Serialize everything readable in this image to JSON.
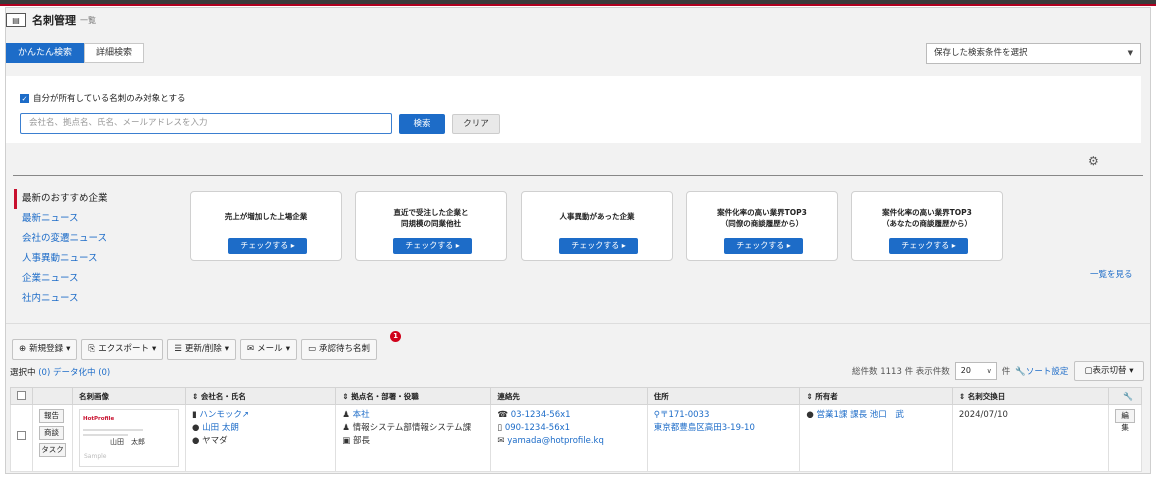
{
  "header": {
    "title": "名刺管理",
    "subtitle": "一覧",
    "icon": "contact-card-icon"
  },
  "search_tabs": [
    {
      "label": "かんたん検索",
      "active": true
    },
    {
      "label": "詳細検索",
      "active": false
    }
  ],
  "saved_search": {
    "placeholder": "保存した検索条件を選択"
  },
  "search": {
    "own_only_label": "自分が所有している名刺のみ対象とする",
    "own_only_checked": true,
    "placeholder": "会社名、拠点名、氏名、メールアドレスを入力",
    "search_label": "検索",
    "clear_label": "クリア"
  },
  "news_nav": [
    {
      "label": "最新のおすすめ企業",
      "active": true
    },
    {
      "label": "最新ニュース",
      "active": false
    },
    {
      "label": "会社の変遷ニュース",
      "active": false
    },
    {
      "label": "人事異動ニュース",
      "active": false
    },
    {
      "label": "企業ニュース",
      "active": false
    },
    {
      "label": "社内ニュース",
      "active": false
    }
  ],
  "cards": [
    {
      "line1": "売上が増加した上場企業",
      "line2": "",
      "button": "チェックする ▸"
    },
    {
      "line1": "直近で受注した企業と",
      "line2": "同規模の同業他社",
      "button": "チェックする ▸"
    },
    {
      "line1": "人事異動があった企業",
      "line2": "",
      "button": "チェックする ▸"
    },
    {
      "line1": "案件化率の高い業界TOP3",
      "line2": "（同僚の商談履歴から）",
      "button": "チェックする ▸"
    },
    {
      "line1": "案件化率の高い業界TOP3",
      "line2": "（あなたの商談履歴から）",
      "button": "チェックする ▸"
    }
  ],
  "see_all": "一覧を見る",
  "toolbar": {
    "new_label": "新規登録",
    "export_label": "エクスポート",
    "update_label": "更新/削除",
    "mail_label": "メール",
    "approval_label": "承認待ち名刺",
    "approval_badge": "1"
  },
  "selection": {
    "selected_label": "選択中",
    "selected_count": "(0)",
    "digitizing_label": "データ化中",
    "digitizing_count": "(0)"
  },
  "totals": {
    "total_label": "総件数",
    "total_count": "1113",
    "unit": "件",
    "per_page_label": "表示件数",
    "per_page_value": "20",
    "per_page_unit": "件",
    "sort_label": "ソート設定",
    "view_label": "表示切替"
  },
  "columns": [
    "名刺画像",
    "会社名・氏名",
    "拠点名・部署・役職",
    "連絡先",
    "住所",
    "所有者",
    "名刺交換日"
  ],
  "row": {
    "actions": [
      "報告",
      "商談",
      "タスク"
    ],
    "card_logo": "HotProfile",
    "card_name": "山田　太郎",
    "card_sample": "Sample",
    "company": "ハンモック",
    "person": "山田 太朗",
    "kana": "ヤマダ",
    "branch": "本社",
    "department": "情報システム部情報システム課",
    "title": "部長",
    "phone": "03-1234-56x1",
    "mobile": "090-1234-56x1",
    "email": "yamada@hotprofile.kq",
    "postal": "〒171-0033",
    "address": "東京都豊島区高田3-19-10",
    "owner": "営業1課 課長 池口　武",
    "exchange_date": "2024/07/10",
    "edit_label": "編集"
  }
}
